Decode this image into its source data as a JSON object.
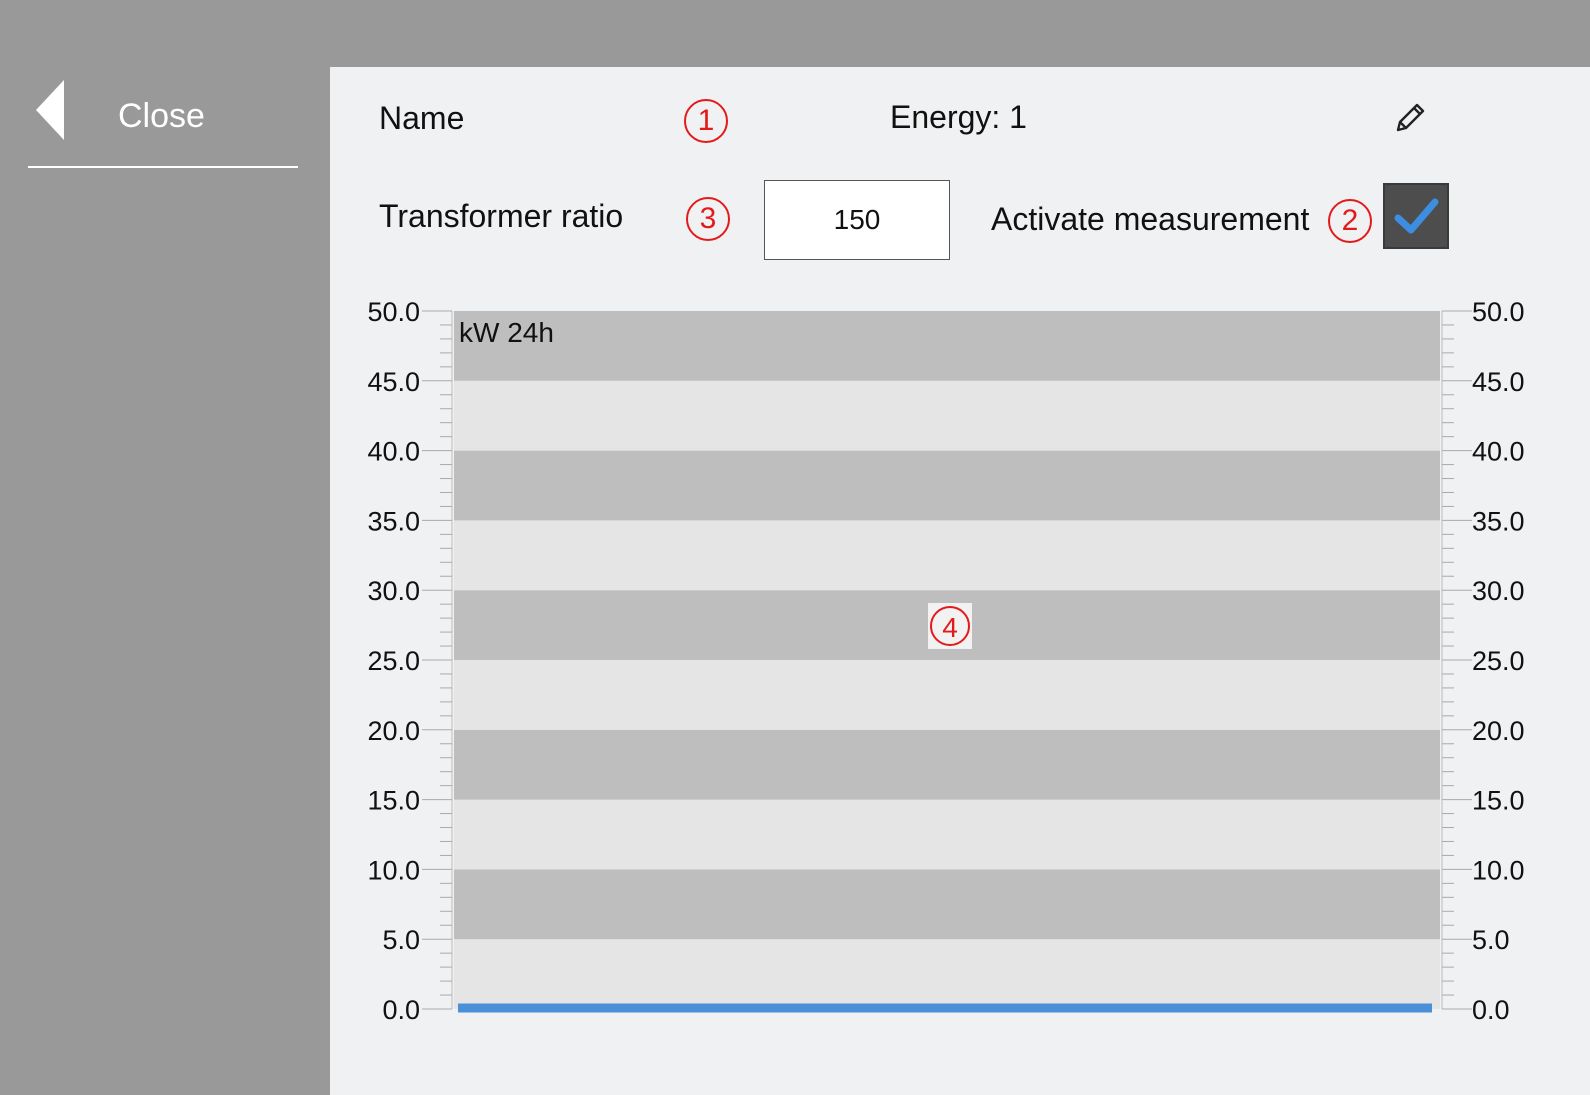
{
  "sidebar": {
    "close_label": "Close"
  },
  "form": {
    "name_label": "Name",
    "name_value": "Energy: 1",
    "ratio_label": "Transformer ratio",
    "ratio_value": "150",
    "activate_label": "Activate measurement",
    "activate_checked": true
  },
  "annotations": [
    "1",
    "2",
    "3",
    "4"
  ],
  "icons": {
    "back": "back-arrow-icon",
    "edit": "pencil-icon",
    "check": "checkmark-icon"
  },
  "colors": {
    "series": "#4a90d9",
    "band_dark": "#bebebe",
    "band_light": "#e5e5e5",
    "annotation": "#e41a1a"
  },
  "chart_data": {
    "type": "line",
    "title": "kW 24h",
    "ylim": [
      0,
      50
    ],
    "y_ticks": [
      "0.0",
      "5.0",
      "10.0",
      "15.0",
      "20.0",
      "25.0",
      "30.0",
      "35.0",
      "40.0",
      "45.0",
      "50.0"
    ],
    "series": [
      {
        "values": [
          0,
          0
        ]
      }
    ],
    "grid": "alternating bands",
    "y_axis_both_sides": true
  }
}
